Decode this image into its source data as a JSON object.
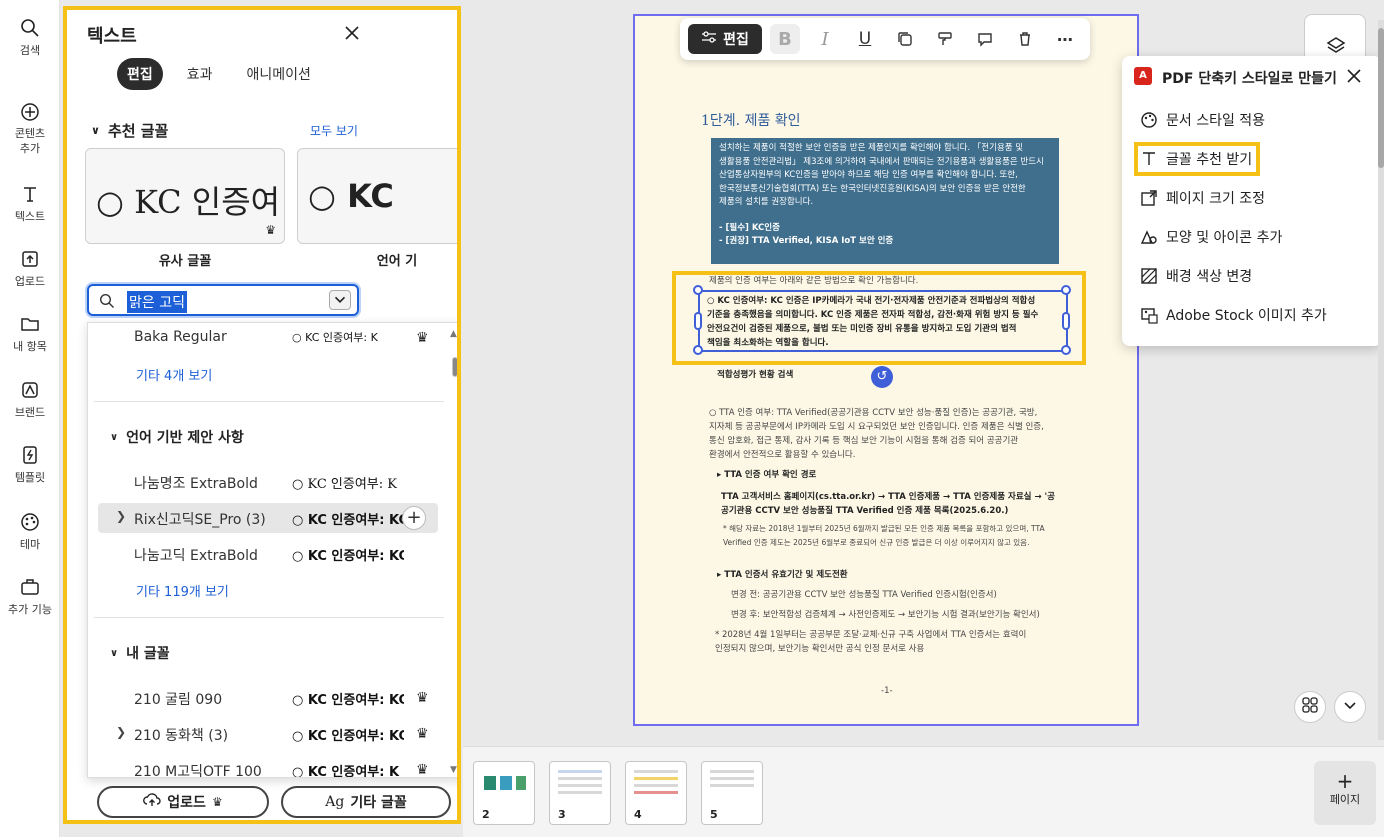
{
  "rail": {
    "items": [
      {
        "label": "검색",
        "icon": "search-icon"
      },
      {
        "label": "콘텐츠\n추가",
        "icon": "add-content-icon"
      },
      {
        "label": "텍스트",
        "icon": "text-icon"
      },
      {
        "label": "업로드",
        "icon": "upload-icon"
      },
      {
        "label": "내 항목",
        "icon": "folder-icon"
      },
      {
        "label": "브랜드",
        "icon": "brand-icon"
      },
      {
        "label": "템플릿",
        "icon": "template-icon"
      },
      {
        "label": "테마",
        "icon": "palette-icon"
      },
      {
        "label": "추가 기능",
        "icon": "addons-icon"
      }
    ]
  },
  "panel": {
    "title": "텍스트",
    "tabs": [
      "편집",
      "효과",
      "애니메이션"
    ],
    "recommended_heading": "추천 글꼴",
    "see_all": "모두 보기",
    "cards": [
      {
        "sample": "○ KC 인증여",
        "label": "유사 글꼴"
      },
      {
        "sample": "○ KC",
        "label": "언어 기"
      }
    ],
    "search_value": "맑은 고딕",
    "dropdown": {
      "top_row": {
        "name": "Baka Regular",
        "preview": "○ KC 인증여부: K"
      },
      "more1": "기타 4개 보기",
      "section_lang": "언어 기반 제안 사항",
      "lang_rows": [
        {
          "name": "나눔명조 ExtraBold",
          "preview": "○ KC 인증여부: K"
        },
        {
          "name": "Rix신고딕SE_Pro (3)",
          "preview": "○ KC 인증여부: KC"
        },
        {
          "name": "나눔고딕 ExtraBold",
          "preview": "○ KC 인증여부: KC"
        }
      ],
      "more2": "기타 119개 보기",
      "section_mine": "내 글꼴",
      "my_rows": [
        {
          "name": "210 굴림 090",
          "preview": "○ KC 인증여부: KC"
        },
        {
          "name": "210 동화책 (3)",
          "preview": "○ KC 인증여부: KC"
        },
        {
          "name": "210 M고딕OTF 100",
          "preview": "○ KC 인증여부: K"
        }
      ]
    },
    "upload_label": "업로드",
    "other_fonts_label": "기타 글꼴"
  },
  "toolbar": {
    "edit_label": "편집"
  },
  "doc": {
    "heading": "1단계. 제품 확인",
    "box_lines": [
      "설치하는 제품이 적절한 보안 인증을 받은 제품인지를 확인해야 합니다. 「전기용품 및",
      "생활용품 안전관리법」 제3조에 의거하여 국내에서 판매되는 전기용품과 생활용품은 반드시",
      "산업통상자원부의 KC인증을 받아야 하므로 해당 인증 여부를 확인해야 합니다. 또한,",
      "한국정보통신기술협회(TTA) 또는 한국인터넷진흥원(KISA)의 보안 인증을 받은 안전한",
      "제품의 설치를 권장합니다."
    ],
    "box_bullets": [
      "- [필수] KC인증",
      "- [권장] TTA Verified, KISA IoT 보안 인증"
    ],
    "line_after_box": "제품의 인증 여부는 아래와 같은 방법으로 확인 가능합니다.",
    "selected_lines": [
      "○ KC 인증여부: KC 인증은 IP카메라가 국내 전기·전자제품 안전기준과 전파법상의 적합성",
      "기준을 충족했음을 의미합니다. KC 인증 제품은 전자파 적합성, 감전·화재 위험 방지 등 필수",
      "안전요건이 검증된 제품으로, 불법 또는 미인증 장비 유통을 방지하고 도입 기관의 법적",
      "책임을 최소화하는 역할을 합니다."
    ],
    "below_sel": "적합성평가 현황 검색",
    "tta_lines": [
      "○ TTA 인증 여부: TTA Verified(공공기관용 CCTV 보안 성능·품질 인증)는 공공기관, 국방,",
      "지자체 등 공공부문에서 IP카메라 도입 시 요구되었던 보안 인증입니다. 인증 제품은 식별 인증,",
      "통신 암호화, 접근 통제, 감사 기록 등 핵심 보안 기능이 시험을 통해 검증 되어 공공기관",
      "환경에서 안전적으로 활용할 수 있습니다."
    ],
    "tta_check": "▸ TTA 인증 여부 확인 경로",
    "tta_path": [
      "TTA 고객서비스 홈페이지(cs.tta.or.kr) → TTA 인증제품 → TTA 인증제품 자료실 → '공",
      "공기관용 CCTV 보안 성능품질 TTA Verified 인증 제품 목록(2025.6.20.)"
    ],
    "tta_note": [
      "* 해당 자료는 2018년 1월부터 2025년 6월까지 발급된 모든 인증 제품 목록을 포함하고 있으며, TTA",
      "Verified 인증 제도는 2025년 6월부로 종료되어 신규 인증 발급은 더 이상 이루어지지 않고 있음."
    ],
    "tta_valid": "▸ TTA 인증서 유효기간 및 제도전환",
    "before": "변경 전: 공공기관용 CCTV 보안 성능품질 TTA Verified 인증시험(인증서)",
    "after": "변경 후: 보안적합성 검증체계 → 사전인증제도 → 보안기능 시험 결과(보안기능 확인서)",
    "final_note": [
      "* 2028년 4월 1일부터는 공공부문 조달·교체·신규 구축 사업에서 TTA 인증서는 효력이",
      "인정되지 않으며, 보안기능 확인서만 공식 인정 문서로 사용"
    ],
    "page_num": "-1-"
  },
  "popup": {
    "title": "PDF 단축키 스타일로 만들기",
    "items": [
      {
        "label": "문서 스타일 적용",
        "icon": "palette-icon"
      },
      {
        "label": "글꼴 추천 받기",
        "icon": "text-t-icon"
      },
      {
        "label": "페이지 크기 조정",
        "icon": "resize-icon"
      },
      {
        "label": "모양 및 아이콘 추가",
        "icon": "shapes-icon"
      },
      {
        "label": "배경 색상 변경",
        "icon": "background-icon"
      },
      {
        "label": "Adobe Stock 이미지 추가",
        "icon": "stock-icon"
      }
    ]
  },
  "thumbs": [
    "2",
    "3",
    "4",
    "5"
  ],
  "add_page_label": "페이지",
  "colors": {
    "highlight": "#f5c116",
    "accent": "#1d5fd6",
    "page_border": "#6f6cf0"
  }
}
